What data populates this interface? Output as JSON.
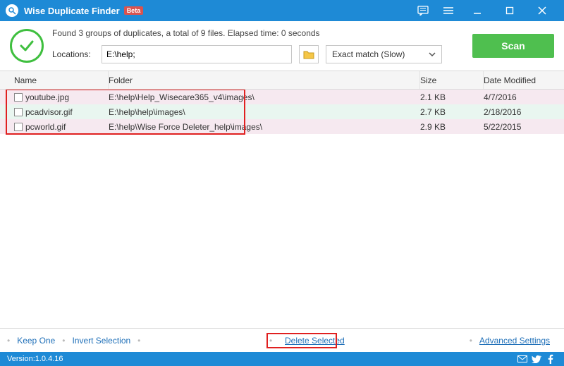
{
  "title": "Wise Duplicate Finder",
  "beta": "Beta",
  "status_msg": "Found 3 groups of duplicates, a total of 9 files. Elapsed time: 0 seconds",
  "locations_label": "Locations:",
  "locations_value": "E:\\help;",
  "mode_selected": "Exact match (Slow)",
  "scan_label": "Scan",
  "columns": {
    "name": "Name",
    "folder": "Folder",
    "size": "Size",
    "date": "Date Modified"
  },
  "rows": [
    {
      "name": "youtube.jpg",
      "folder": "E:\\help\\Help_Wisecare365_v4\\images\\",
      "size": "2.1 KB",
      "date": "4/7/2016"
    },
    {
      "name": "pcadvisor.gif",
      "folder": "E:\\help\\help\\images\\",
      "size": "2.7 KB",
      "date": "2/18/2016"
    },
    {
      "name": "pcworld.gif",
      "folder": "E:\\help\\Wise Force Deleter_help\\images\\",
      "size": "2.9 KB",
      "date": "5/22/2015"
    }
  ],
  "bottom": {
    "keep_one": "Keep One",
    "invert": "Invert Selection",
    "delete": "Delete Selected",
    "advanced": "Advanced Settings"
  },
  "version_label": "Version:",
  "version": "1.0.4.16"
}
